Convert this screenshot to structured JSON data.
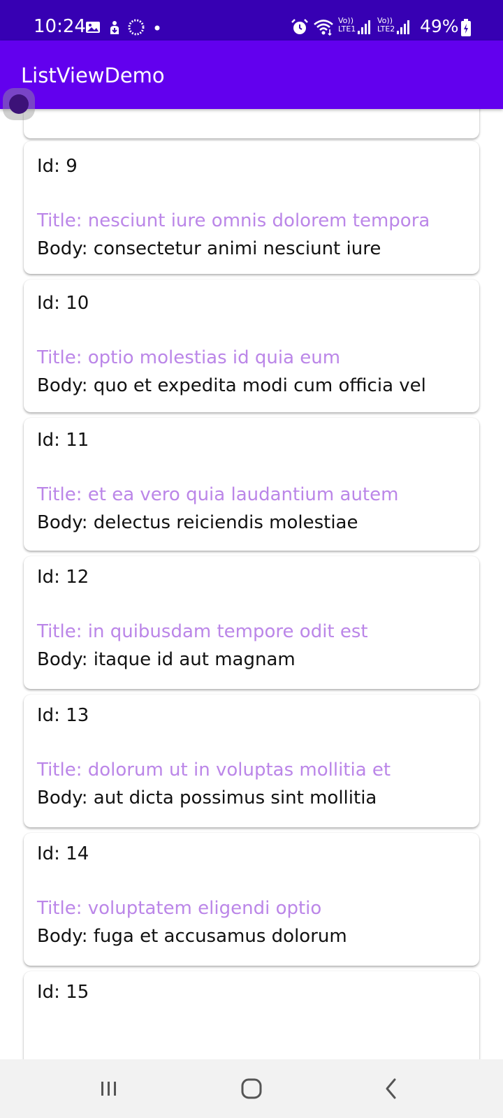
{
  "status_bar": {
    "time": "10:24",
    "battery": "49%",
    "icons": [
      "image-icon",
      "download-icon",
      "loading-icon",
      "dot-icon",
      "alarm-icon",
      "wifi-icon",
      "lte1-signal-icon",
      "lte2-signal-icon",
      "battery-charging-icon"
    ],
    "lte1_label": "LTE1",
    "lte2_label": "LTE2",
    "volte_label": "Vo))"
  },
  "app_bar": {
    "title": "ListViewDemo",
    "color": "#6200ee"
  },
  "colors": {
    "status_bar": "#3700b3",
    "title_text": "#bb86e8",
    "body_text": "#111111"
  },
  "list": {
    "items": [
      {
        "id": "Id: 9",
        "title": "Title: nesciunt iure omnis dolorem tempora",
        "body": "Body: consectetur animi nesciunt iure"
      },
      {
        "id": "Id: 10",
        "title": "Title: optio molestias id quia eum",
        "body": "Body: quo et expedita modi cum officia vel"
      },
      {
        "id": "Id: 11",
        "title": "Title: et ea vero quia laudantium autem",
        "body": "Body: delectus reiciendis molestiae"
      },
      {
        "id": "Id: 12",
        "title": "Title: in quibusdam tempore odit est",
        "body": "Body: itaque id aut magnam"
      },
      {
        "id": "Id: 13",
        "title": "Title: dolorum ut in voluptas mollitia et",
        "body": "Body: aut dicta possimus sint mollitia"
      },
      {
        "id": "Id: 14",
        "title": "Title: voluptatem eligendi optio",
        "body": "Body: fuga et accusamus dolorum"
      },
      {
        "id": "Id: 15"
      }
    ]
  },
  "nav_bar": {
    "buttons": [
      "recent-apps-icon",
      "home-icon",
      "back-icon"
    ]
  }
}
